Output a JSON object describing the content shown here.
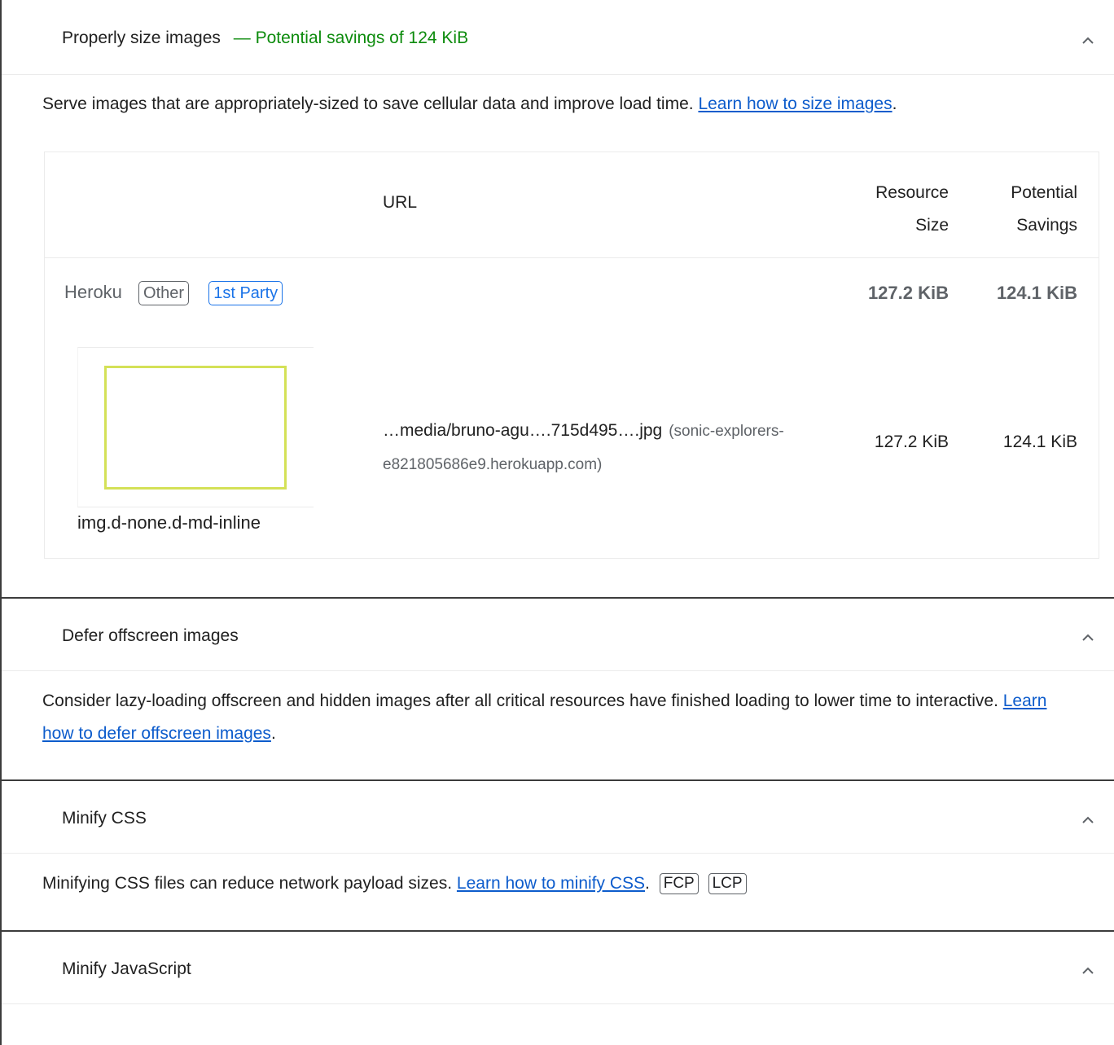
{
  "audits": [
    {
      "title": "Properly size images",
      "savings": "— Potential savings of 124 KiB",
      "description": "Serve images that are appropriately-sized to save cellular data and improve load time.",
      "link_text": "Learn how to size images",
      "table": {
        "col_url": "URL",
        "col_size_1": "Resource",
        "col_size_2": "Size",
        "col_sav_1": "Potential",
        "col_sav_2": "Savings",
        "entity": {
          "name": "Heroku",
          "tag_other": "Other",
          "tag_party": "1st Party",
          "size": "127.2 KiB",
          "savings": "124.1 KiB"
        },
        "row": {
          "node_label": "img.d-none.d-md-inline",
          "url": "…media/bruno-agu….715d495….jpg",
          "origin": "(sonic-explorers-e821805686e9.herokuapp.com)",
          "size": "127.2 KiB",
          "savings": "124.1 KiB"
        }
      }
    },
    {
      "title": "Defer offscreen images",
      "description": "Consider lazy-loading offscreen and hidden images after all critical resources have finished loading to lower time to interactive.",
      "link_text": "Learn how to defer offscreen images"
    },
    {
      "title": "Minify CSS",
      "description": "Minifying CSS files can reduce network payload sizes.",
      "link_text": "Learn how to minify CSS",
      "tags": [
        "FCP",
        "LCP"
      ]
    },
    {
      "title": "Minify JavaScript"
    }
  ],
  "colors": {
    "savings_green": "#0c8b0c",
    "link_blue": "#0d5ccc",
    "first_party_blue": "#1a73e8",
    "thumbnail_border": "#d4e157"
  },
  "icons": {
    "collapse": "chevron-up-icon"
  }
}
